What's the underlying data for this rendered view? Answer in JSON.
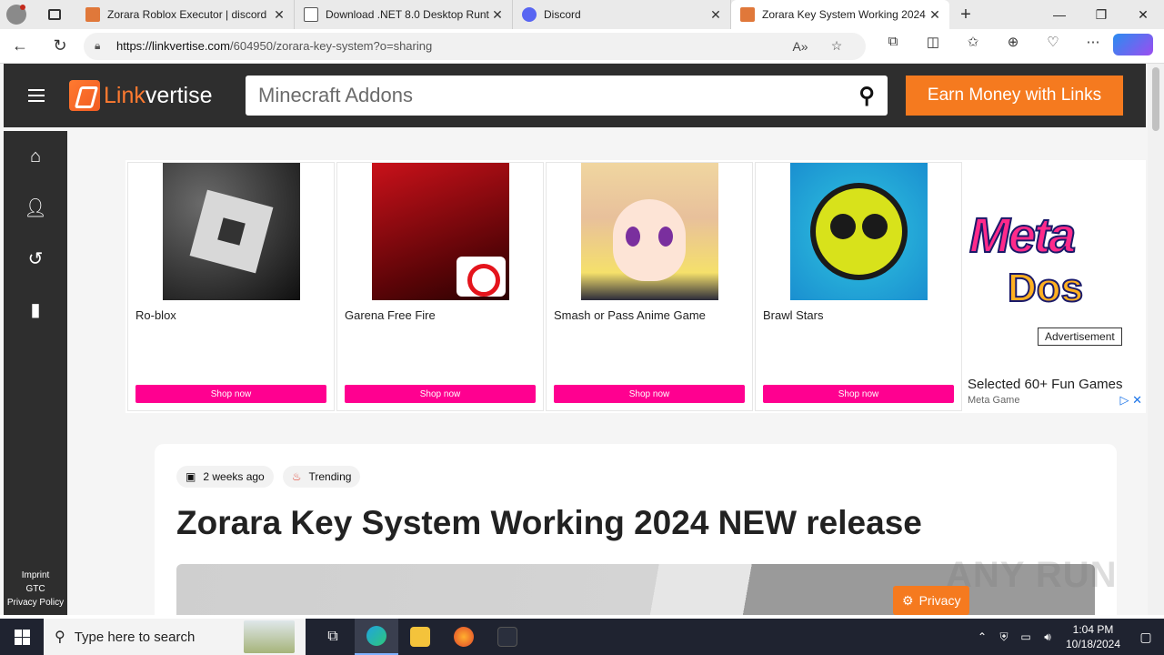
{
  "browser": {
    "tabs": [
      {
        "title": "Zorara Roblox Executor | discord",
        "favicon_color": "#e0783a",
        "active": false
      },
      {
        "title": "Download .NET 8.0 Desktop Runt",
        "favicon_color": "#ffffff",
        "active": false
      },
      {
        "title": "Discord",
        "favicon_color": "#5865f2",
        "active": false
      },
      {
        "title": "Zorara Key System Working 2024",
        "favicon_color": "#e0783a",
        "active": true
      }
    ],
    "new_tab": "+",
    "window_controls": {
      "minimize": "—",
      "maximize": "❐",
      "close": "✕"
    },
    "url_host": "https://linkvertise.com",
    "url_path": "/604950/zorara-key-system?o=sharing"
  },
  "header": {
    "logo_link": "Link",
    "logo_vertise": "vertise",
    "search_placeholder": "Minecraft Addons",
    "earn_button": "Earn Money with Links"
  },
  "leftnav": {
    "icons": [
      "home-icon",
      "user-icon",
      "history-icon",
      "bookmark-icon"
    ],
    "links": [
      "Imprint",
      "GTC",
      "Privacy Policy"
    ]
  },
  "ads": {
    "cards": [
      {
        "name": "Ro-blox",
        "button": "Shop now"
      },
      {
        "name": "Garena Free Fire",
        "button": "Shop now"
      },
      {
        "name": "Smash or Pass Anime Game",
        "button": "Shop now"
      },
      {
        "name": "Brawl Stars",
        "button": "Shop now"
      }
    ],
    "side": {
      "logo_top": "Meta",
      "logo_bottom": "Dos",
      "label": "Advertisement",
      "headline": "Selected 60+ Fun Games",
      "source": "Meta Game",
      "adchoices": "▷ ✕"
    }
  },
  "article": {
    "date": "2 weeks ago",
    "tag": "Trending",
    "title": "Zorara Key System Working 2024 NEW release"
  },
  "privacy_button": "Privacy",
  "watermark": "ANY RUN",
  "taskbar": {
    "search_placeholder": "Type here to search",
    "time": "1:04 PM",
    "date": "10/18/2024"
  },
  "colors": {
    "accent_orange": "#f57a1f",
    "shop_pink": "#ff0090",
    "header_dark": "#2e2e2e"
  }
}
